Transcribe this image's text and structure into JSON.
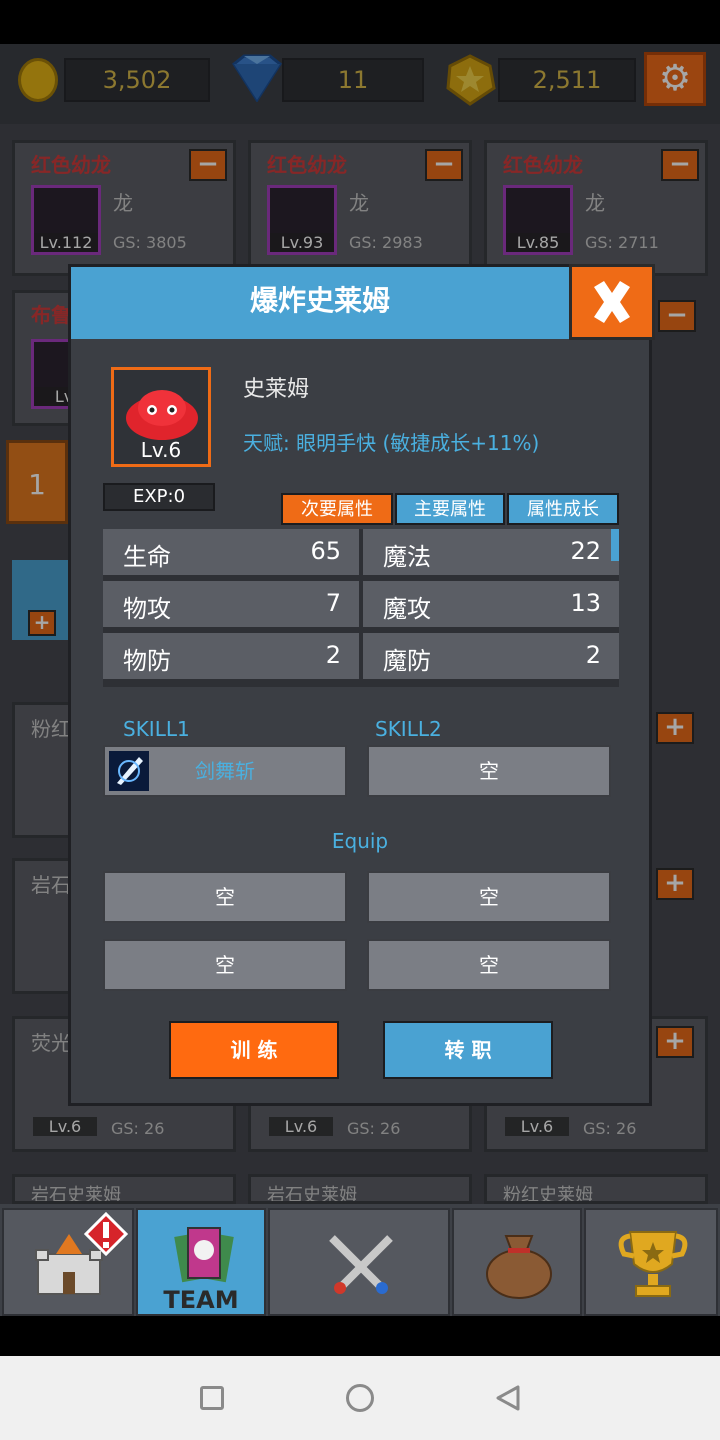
{
  "currency": {
    "gold": "3,502",
    "gems": "11",
    "medals": "2,511"
  },
  "icons": {
    "gold": "gold-coin-icon",
    "gem": "diamond-icon",
    "medal": "medal-icon",
    "settings": "gear-icon",
    "close": "close-x-icon"
  },
  "colors": {
    "accent_orange": "#ef6b16",
    "accent_blue": "#4aa2d2",
    "card_name_red": "#d03c3c",
    "talent_blue": "#4ab0e0"
  },
  "team_cards": [
    {
      "name": "红色幼龙",
      "type": "龙",
      "level": "Lv.112",
      "gs": "GS: 3805"
    },
    {
      "name": "红色幼龙",
      "type": "龙",
      "level": "Lv.93",
      "gs": "GS: 2983"
    },
    {
      "name": "红色幼龙",
      "type": "龙",
      "level": "Lv.85",
      "gs": "GS: 2711"
    }
  ],
  "partial_card": {
    "name_fragment": "布鲁",
    "level_fragment": "Lv."
  },
  "formation_badge": "1",
  "left_list_fragments": [
    "粉红",
    "岩石",
    "荧光"
  ],
  "bottom_cards": [
    {
      "level": "Lv.6",
      "gs": "GS: 26"
    },
    {
      "level": "Lv.6",
      "gs": "GS: 26"
    },
    {
      "level": "Lv.6",
      "gs": "GS: 26"
    }
  ],
  "row_names": [
    "岩石史莱姆",
    "岩石史莱姆",
    "粉红史莱姆"
  ],
  "modal": {
    "title": "爆炸史莱姆",
    "monster_name": "史莱姆",
    "level": "Lv.6",
    "talent": "天赋: 眼明手快 (敏捷成长+11%)",
    "exp": "EXP:0",
    "tabs": [
      "次要属性",
      "主要属性",
      "属性成长"
    ],
    "stats": [
      {
        "k": "生命",
        "v": "65"
      },
      {
        "k": "魔法",
        "v": "22"
      },
      {
        "k": "物攻",
        "v": "7"
      },
      {
        "k": "魔攻",
        "v": "13"
      },
      {
        "k": "物防",
        "v": "2"
      },
      {
        "k": "魔防",
        "v": "2"
      }
    ],
    "skill1_label": "SKILL1",
    "skill2_label": "SKILL2",
    "skill1_name": "剑舞斩",
    "skill2_name": "空",
    "equip_label": "Equip",
    "equip_slots": [
      "空",
      "空",
      "空",
      "空"
    ],
    "train_label": "训 练",
    "job_label": "转 职"
  },
  "nav": {
    "team_label": "TEAM",
    "items": [
      "castle-icon",
      "team-icon",
      "crossed-swords-icon",
      "money-bag-icon",
      "trophy-icon"
    ]
  }
}
